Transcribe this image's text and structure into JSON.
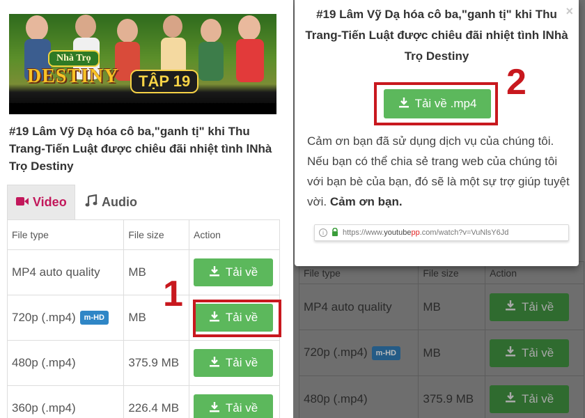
{
  "left": {
    "thumbnail": {
      "logo_small": "Nhà Trọ",
      "logo_big": "DESTINY",
      "episode": "TẬP 19"
    },
    "video_title": "#19 Lâm Vỹ Dạ hóa cô ba,\"ganh tị\" khi Thu Trang-Tiến Luật được chiêu đãi nhiệt tình lNhà Trọ Destiny",
    "tabs": [
      {
        "label": "Video",
        "icon": "video-camera-icon",
        "active": true
      },
      {
        "label": "Audio",
        "icon": "music-note-icon",
        "active": false
      }
    ],
    "table": {
      "headers": [
        "File type",
        "File size",
        "Action"
      ],
      "rows": [
        {
          "type": "MP4 auto quality",
          "badge": "",
          "size": "MB",
          "action": "Tải về"
        },
        {
          "type": "720p (.mp4)",
          "badge": "m-HD",
          "size": "MB",
          "action": "Tải về"
        },
        {
          "type": "480p (.mp4)",
          "badge": "",
          "size": "375.9 MB",
          "action": "Tải về"
        },
        {
          "type": "360p (.mp4)",
          "badge": "",
          "size": "226.4 MB",
          "action": "Tải về"
        }
      ]
    },
    "step": "1"
  },
  "right": {
    "modal": {
      "title": "#19 Lâm Vỹ Dạ hóa cô ba,\"ganh tị\" khi Thu Trang-Tiến Luật được chiêu đãi nhiệt tình lNhà Trọ Destiny",
      "close": "×",
      "download_label": "Tải về .mp4",
      "message": "Cảm ơn bạn đã sử dụng dịch vụ của chúng tôi. Nếu bạn có thể chia sẻ trang web của chúng tôi với bạn bè của bạn, đó sẽ là một sự trợ giúp tuyệt vời.",
      "message_bold": "Cảm ơn bạn.",
      "url_prefix": "https://www.",
      "url_host": "youtube",
      "url_pp": "pp",
      "url_rest": ".com/watch?v=VuNlsY6Jd"
    },
    "table": {
      "headers": [
        "File type",
        "File size",
        "Action"
      ],
      "rows": [
        {
          "type": "MP4 auto quality",
          "badge": "",
          "size": "MB",
          "action": "Tải về"
        },
        {
          "type": "720p (.mp4)",
          "badge": "m-HD",
          "size": "MB",
          "action": "Tải về"
        },
        {
          "type": "480p (.mp4)",
          "badge": "",
          "size": "375.9 MB",
          "action": "Tải về"
        }
      ]
    },
    "step": "2"
  },
  "colors": {
    "accent_red": "#c8181e",
    "button_green": "#5cb85c",
    "tab_active": "#c2185b",
    "badge_blue": "#2f86c6"
  }
}
